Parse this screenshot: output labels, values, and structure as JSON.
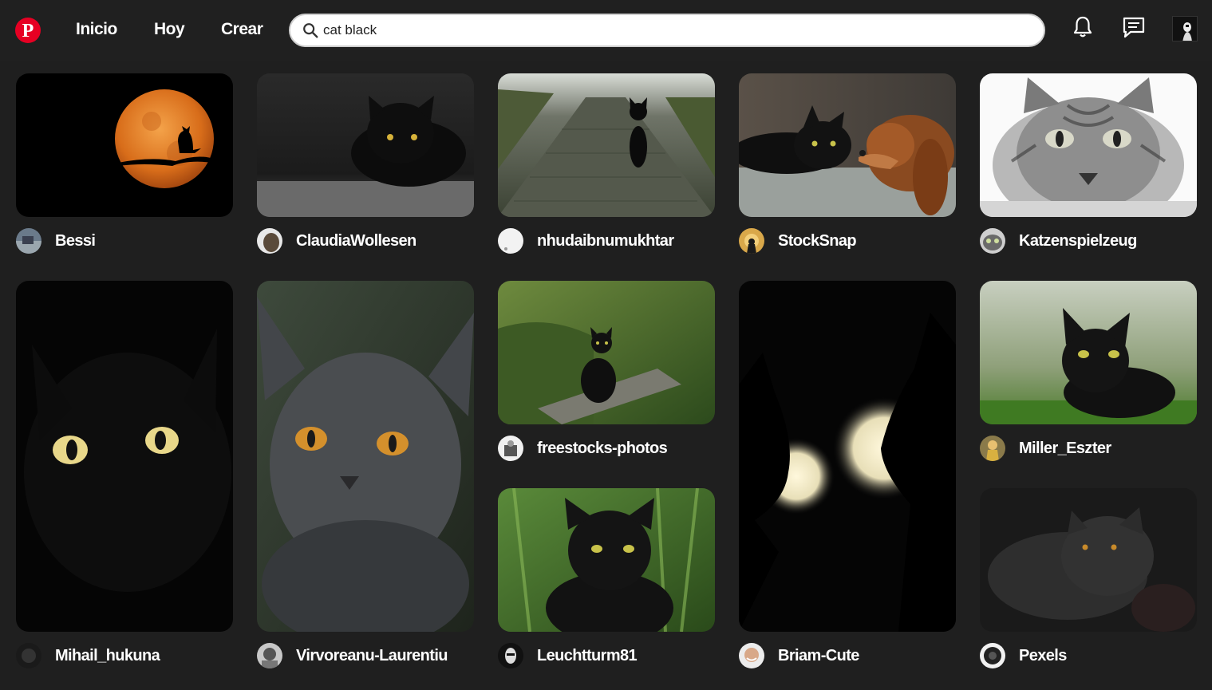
{
  "nav": {
    "logo": "P",
    "home_label": "Inicio",
    "today_label": "Hoy",
    "create_label": "Crear"
  },
  "search": {
    "value": "cat black",
    "placeholder": ""
  },
  "colors": {
    "brand": "#e60023",
    "background": "#1f1f1f"
  },
  "pins": [
    {
      "author": "Bessi"
    },
    {
      "author": "ClaudiaWollesen"
    },
    {
      "author": "nhudaibnumukhtar"
    },
    {
      "author": "StockSnap"
    },
    {
      "author": "Katzenspielzeug"
    },
    {
      "author": "Mihail_hukuna"
    },
    {
      "author": "Virvoreanu-Laurentiu"
    },
    {
      "author": "freestocks-photos"
    },
    {
      "author": "Miller_Eszter"
    },
    {
      "author": "Leuchtturm81"
    },
    {
      "author": "Briam-Cute"
    },
    {
      "author": "Pexels"
    }
  ]
}
